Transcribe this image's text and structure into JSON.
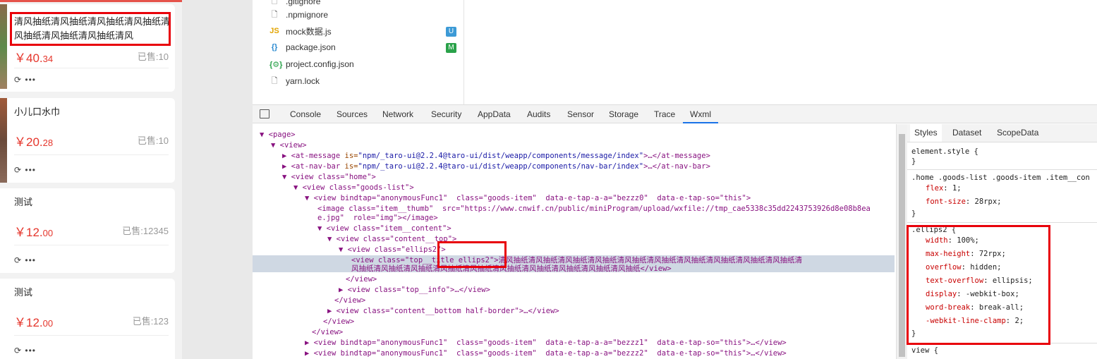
{
  "simulator": {
    "goods": [
      {
        "title": "清风抽纸清风抽纸清风抽纸清风抽纸清风抽纸清风抽纸清风抽纸清风",
        "price_main": "￥40.",
        "price_dec": "34",
        "sold": "已售:10"
      },
      {
        "title": "小儿口水巾",
        "price_main": "￥20.",
        "price_dec": "28",
        "sold": "已售:10"
      },
      {
        "title": "测试",
        "price_main": "￥12.",
        "price_dec": "00",
        "sold": "已售:12345"
      },
      {
        "title": "测试",
        "price_main": "￥12.",
        "price_dec": "00",
        "sold": "已售:123"
      }
    ],
    "actions_icon": "share-icon",
    "more_label": "•••"
  },
  "file_tree": [
    {
      "name": ".gitignore",
      "icon": "file-icon",
      "badge": ""
    },
    {
      "name": ".npmignore",
      "icon": "file-icon",
      "badge": ""
    },
    {
      "name": "mock数据.js",
      "icon": "js-icon",
      "badge": "U"
    },
    {
      "name": "package.json",
      "icon": "json-icon",
      "badge": "M"
    },
    {
      "name": "project.config.json",
      "icon": "config-icon",
      "badge": ""
    },
    {
      "name": "yarn.lock",
      "icon": "file-icon",
      "badge": ""
    }
  ],
  "devtools": {
    "tabs": [
      "Console",
      "Sources",
      "Network",
      "Security",
      "AppData",
      "Audits",
      "Sensor",
      "Storage",
      "Trace",
      "Wxml"
    ],
    "active_tab": "Wxml",
    "styles_tabs": [
      "Styles",
      "Dataset",
      "ScopeData"
    ],
    "code": {
      "l1": "<page>",
      "l2": "<view>",
      "l3_tag": "<at-message",
      "l3_an": " is=",
      "l3_av": "\"npm/_taro-ui@2.2.4@taro-ui/dist/weapp/components/message/index\"",
      "l3_end": ">…</at-message>",
      "l4_tag": "<at-nav-bar",
      "l4_an": " is=",
      "l4_av": "\"npm/_taro-ui@2.2.4@taro-ui/dist/weapp/components/nav-bar/index\"",
      "l4_end": ">…</at-nav-bar>",
      "l5": "<view class=\"home\">",
      "l6": "<view class=\"goods-list\">",
      "l7": "<view bindtap=\"anonymousFunc1\"  class=\"goods-item\"  data-e-tap-a-a=\"bezzz0\"  data-e-tap-so=\"this\">",
      "l8": "<image class=\"item__thumb\"  src=\"https://www.cnwif.cn/public/miniProgram/upload/wxfile://tmp_cae5338c35dd2243753926d8e08b8ea",
      "l9": "e.jpg\"  role=\"img\"></image>",
      "l10": "<view class=\"item__content\">",
      "l11": "<view class=\"content__top\">",
      "l12": "<view class=\"ellips2\">",
      "l13": "<view class=\"top__title ellips2\">清风抽纸清风抽纸清风抽纸清风抽纸清风抽纸清风抽纸清风抽纸清风抽纸清风抽纸清风抽纸清",
      "l14": "风抽纸清风抽纸清风抽纸清风抽纸清风抽纸清风抽纸清风抽纸清风抽纸清风抽纸清风抽纸</view>",
      "l15": "</view>",
      "l16": "<view class=\"top__info\">…</view>",
      "l17": "</view>",
      "l18": "<view class=\"content__bottom half-border\">…</view>",
      "l19": "</view>",
      "l20": "</view>",
      "l21": "<view bindtap=\"anonymousFunc1\"  class=\"goods-item\"  data-e-tap-a-a=\"bezzz1\"  data-e-tap-so=\"this\">…</view>",
      "l22": "<view bindtap=\"anonymousFunc1\"  class=\"goods-item\"  data-e-tap-a-a=\"bezzz2\"  data-e-tap-so=\"this\">…</view>"
    },
    "styles": {
      "s1": "element.style {",
      "s2": "}",
      "s3": ".home .goods-list .goods-item .item__con",
      "s4n": "flex",
      "s4v": ": 1;",
      "s5n": "font-size",
      "s5v": ": 28rpx;",
      "s6": "}",
      "s7": ".ellips2 {",
      "e1n": "width",
      "e1v": ": 100%;",
      "e2n": "max-height",
      "e2v": ": 72rpx;",
      "e3n": "overflow",
      "e3v": ": hidden;",
      "e4n": "text-overflow",
      "e4v": ": ellipsis;",
      "e5n": "display",
      "e5v": ": -webkit-box;",
      "e6n": "word-break",
      "e6v": ": break-all;",
      "e7n": "-webkit-line-clamp",
      "e7v": ": 2;",
      "s8": "}",
      "s9": "view {"
    }
  }
}
